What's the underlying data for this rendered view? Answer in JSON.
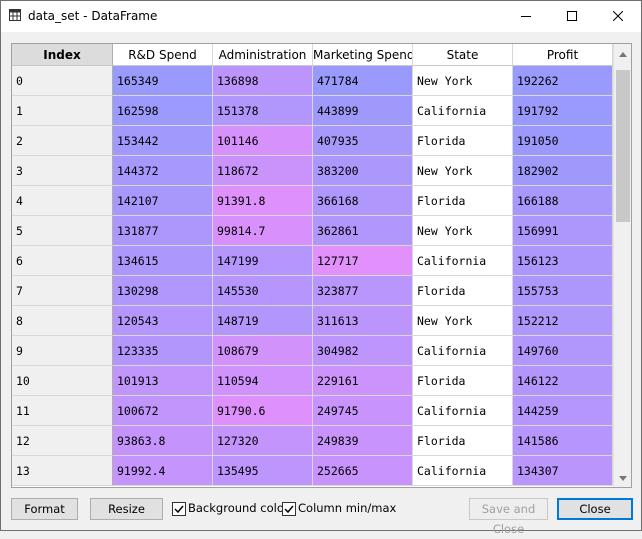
{
  "window": {
    "title": "data_set - DataFrame"
  },
  "columns": [
    "Index",
    "R&D Spend",
    "Administration",
    "Marketing Spend",
    "State",
    "Profit"
  ],
  "rows": [
    [
      "0",
      "165349",
      "136898",
      "471784",
      "New York",
      "192262"
    ],
    [
      "1",
      "162598",
      "151378",
      "443899",
      "California",
      "191792"
    ],
    [
      "2",
      "153442",
      "101146",
      "407935",
      "Florida",
      "191050"
    ],
    [
      "3",
      "144372",
      "118672",
      "383200",
      "New York",
      "182902"
    ],
    [
      "4",
      "142107",
      "91391.8",
      "366168",
      "Florida",
      "166188"
    ],
    [
      "5",
      "131877",
      "99814.7",
      "362861",
      "New York",
      "156991"
    ],
    [
      "6",
      "134615",
      "147199",
      "127717",
      "California",
      "156123"
    ],
    [
      "7",
      "130298",
      "145530",
      "323877",
      "Florida",
      "155753"
    ],
    [
      "8",
      "120543",
      "148719",
      "311613",
      "New York",
      "152212"
    ],
    [
      "9",
      "123335",
      "108679",
      "304982",
      "California",
      "149760"
    ],
    [
      "10",
      "101913",
      "110594",
      "229161",
      "Florida",
      "146122"
    ],
    [
      "11",
      "100672",
      "91790.6",
      "249745",
      "California",
      "144259"
    ],
    [
      "12",
      "93863.8",
      "127320",
      "249839",
      "Florida",
      "141586"
    ],
    [
      "13",
      "91992.4",
      "135495",
      "252665",
      "California",
      "134307"
    ]
  ],
  "colors": {
    "low": "#9a9afc",
    "high": "#fc8cfc",
    "text_bg": "#ffffff",
    "accent": "#0078d7"
  },
  "column_ranges": {
    "R&D Spend": [
      0,
      165349
    ],
    "Administration": [
      51283,
      182646
    ],
    "Marketing Spend": [
      0,
      471784
    ],
    "Profit": [
      14681,
      192262
    ]
  },
  "footer": {
    "format_label": "Format",
    "resize_label": "Resize",
    "background_color_label": "Background color",
    "background_color_checked": true,
    "column_minmax_label": "Column min/max",
    "column_minmax_checked": true,
    "save_close_label": "Save and Close",
    "close_label": "Close"
  }
}
